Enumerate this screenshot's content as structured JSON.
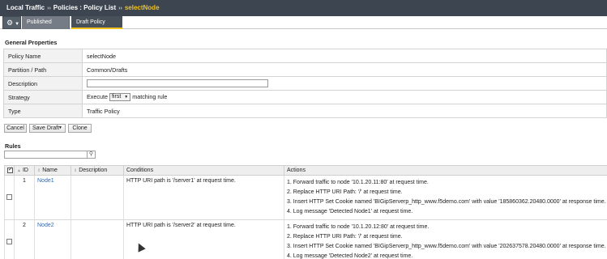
{
  "breadcrumb": {
    "part1": "Local Traffic",
    "separator": "››",
    "part2": "Policies : Policy List",
    "current": "selectNode"
  },
  "tabs": [
    {
      "label": "Published Policy"
    },
    {
      "label": "Draft Policy"
    }
  ],
  "general_properties": {
    "title": "General Properties",
    "policy_name_label": "Policy Name",
    "policy_name_value": "selectNode",
    "partition_label": "Partition / Path",
    "partition_value": "Common/Drafts",
    "description_label": "Description",
    "description_value": "",
    "strategy_label": "Strategy",
    "strategy_prefix": "Execute",
    "strategy_select": "first",
    "strategy_suffix": "matching rule",
    "type_label": "Type",
    "type_value": "Traffic Policy"
  },
  "buttons": {
    "cancel": "Cancel",
    "save_draft": "Save Draft",
    "clone": "Clone"
  },
  "rules": {
    "title": "Rules",
    "filter_placeholder": "",
    "columns": {
      "id": "ID",
      "name": "Name",
      "description": "Description",
      "conditions": "Conditions",
      "actions": "Actions"
    },
    "rows": [
      {
        "id": "1",
        "name": "Node1",
        "description": "",
        "conditions": "HTTP URI path is '/server1' at request time.",
        "actions": [
          "1. Forward traffic to node '10.1.20.11:80' at request time.",
          "2. Replace HTTP URI Path: '/' at request time.",
          "3. Insert HTTP Set Cookie named 'BIGipServerp_http_www.f5demo.com' with value '185860362.20480.0000' at response time.",
          "4. Log message 'Detected Node1' at request time."
        ]
      },
      {
        "id": "2",
        "name": "Node2",
        "description": "",
        "conditions": "HTTP URI path is '/server2' at request time.",
        "actions": [
          "1. Forward traffic to node '10.1.20.12:80' at request time.",
          "2. Replace HTTP URI Path: '/' at request time.",
          "3. Insert HTTP Set Cookie named 'BIGipServerp_http_www.f5demo.com' with value '202637578.20480.0000' at response time.",
          "4. Log message 'Detected Node2' at request time."
        ]
      }
    ]
  },
  "colors": {
    "topbar": "#3d4550",
    "accent": "#f1c21b",
    "link": "#2a6bb5"
  }
}
